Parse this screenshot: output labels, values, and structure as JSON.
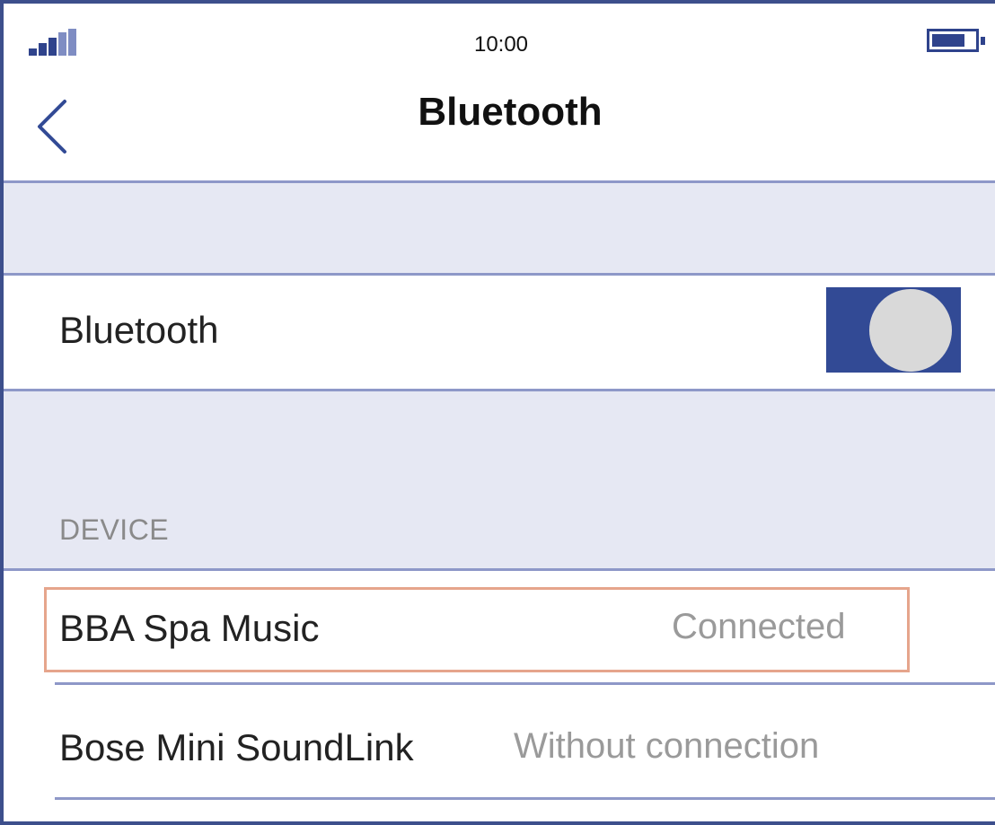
{
  "status_bar": {
    "time": "10:00",
    "signal_icon": "signal-strength-icon",
    "battery_icon": "battery-icon"
  },
  "nav": {
    "back_icon": "chevron-left-icon",
    "title": "Bluetooth"
  },
  "bluetooth_toggle": {
    "label": "Bluetooth",
    "enabled": true
  },
  "devices": {
    "section_header": "DEVICE",
    "items": [
      {
        "name": "BBA Spa Music",
        "status": "Connected",
        "highlighted": true
      },
      {
        "name": "Bose Mini SoundLink",
        "status": "Without connection",
        "highlighted": false
      }
    ]
  },
  "colors": {
    "accent": "#324a95",
    "frame": "#3d4f8c",
    "band": "#e6e8f3",
    "separator": "#8e98c8",
    "highlight_border": "#e6a58c",
    "secondary_text": "#9a9a9a"
  }
}
